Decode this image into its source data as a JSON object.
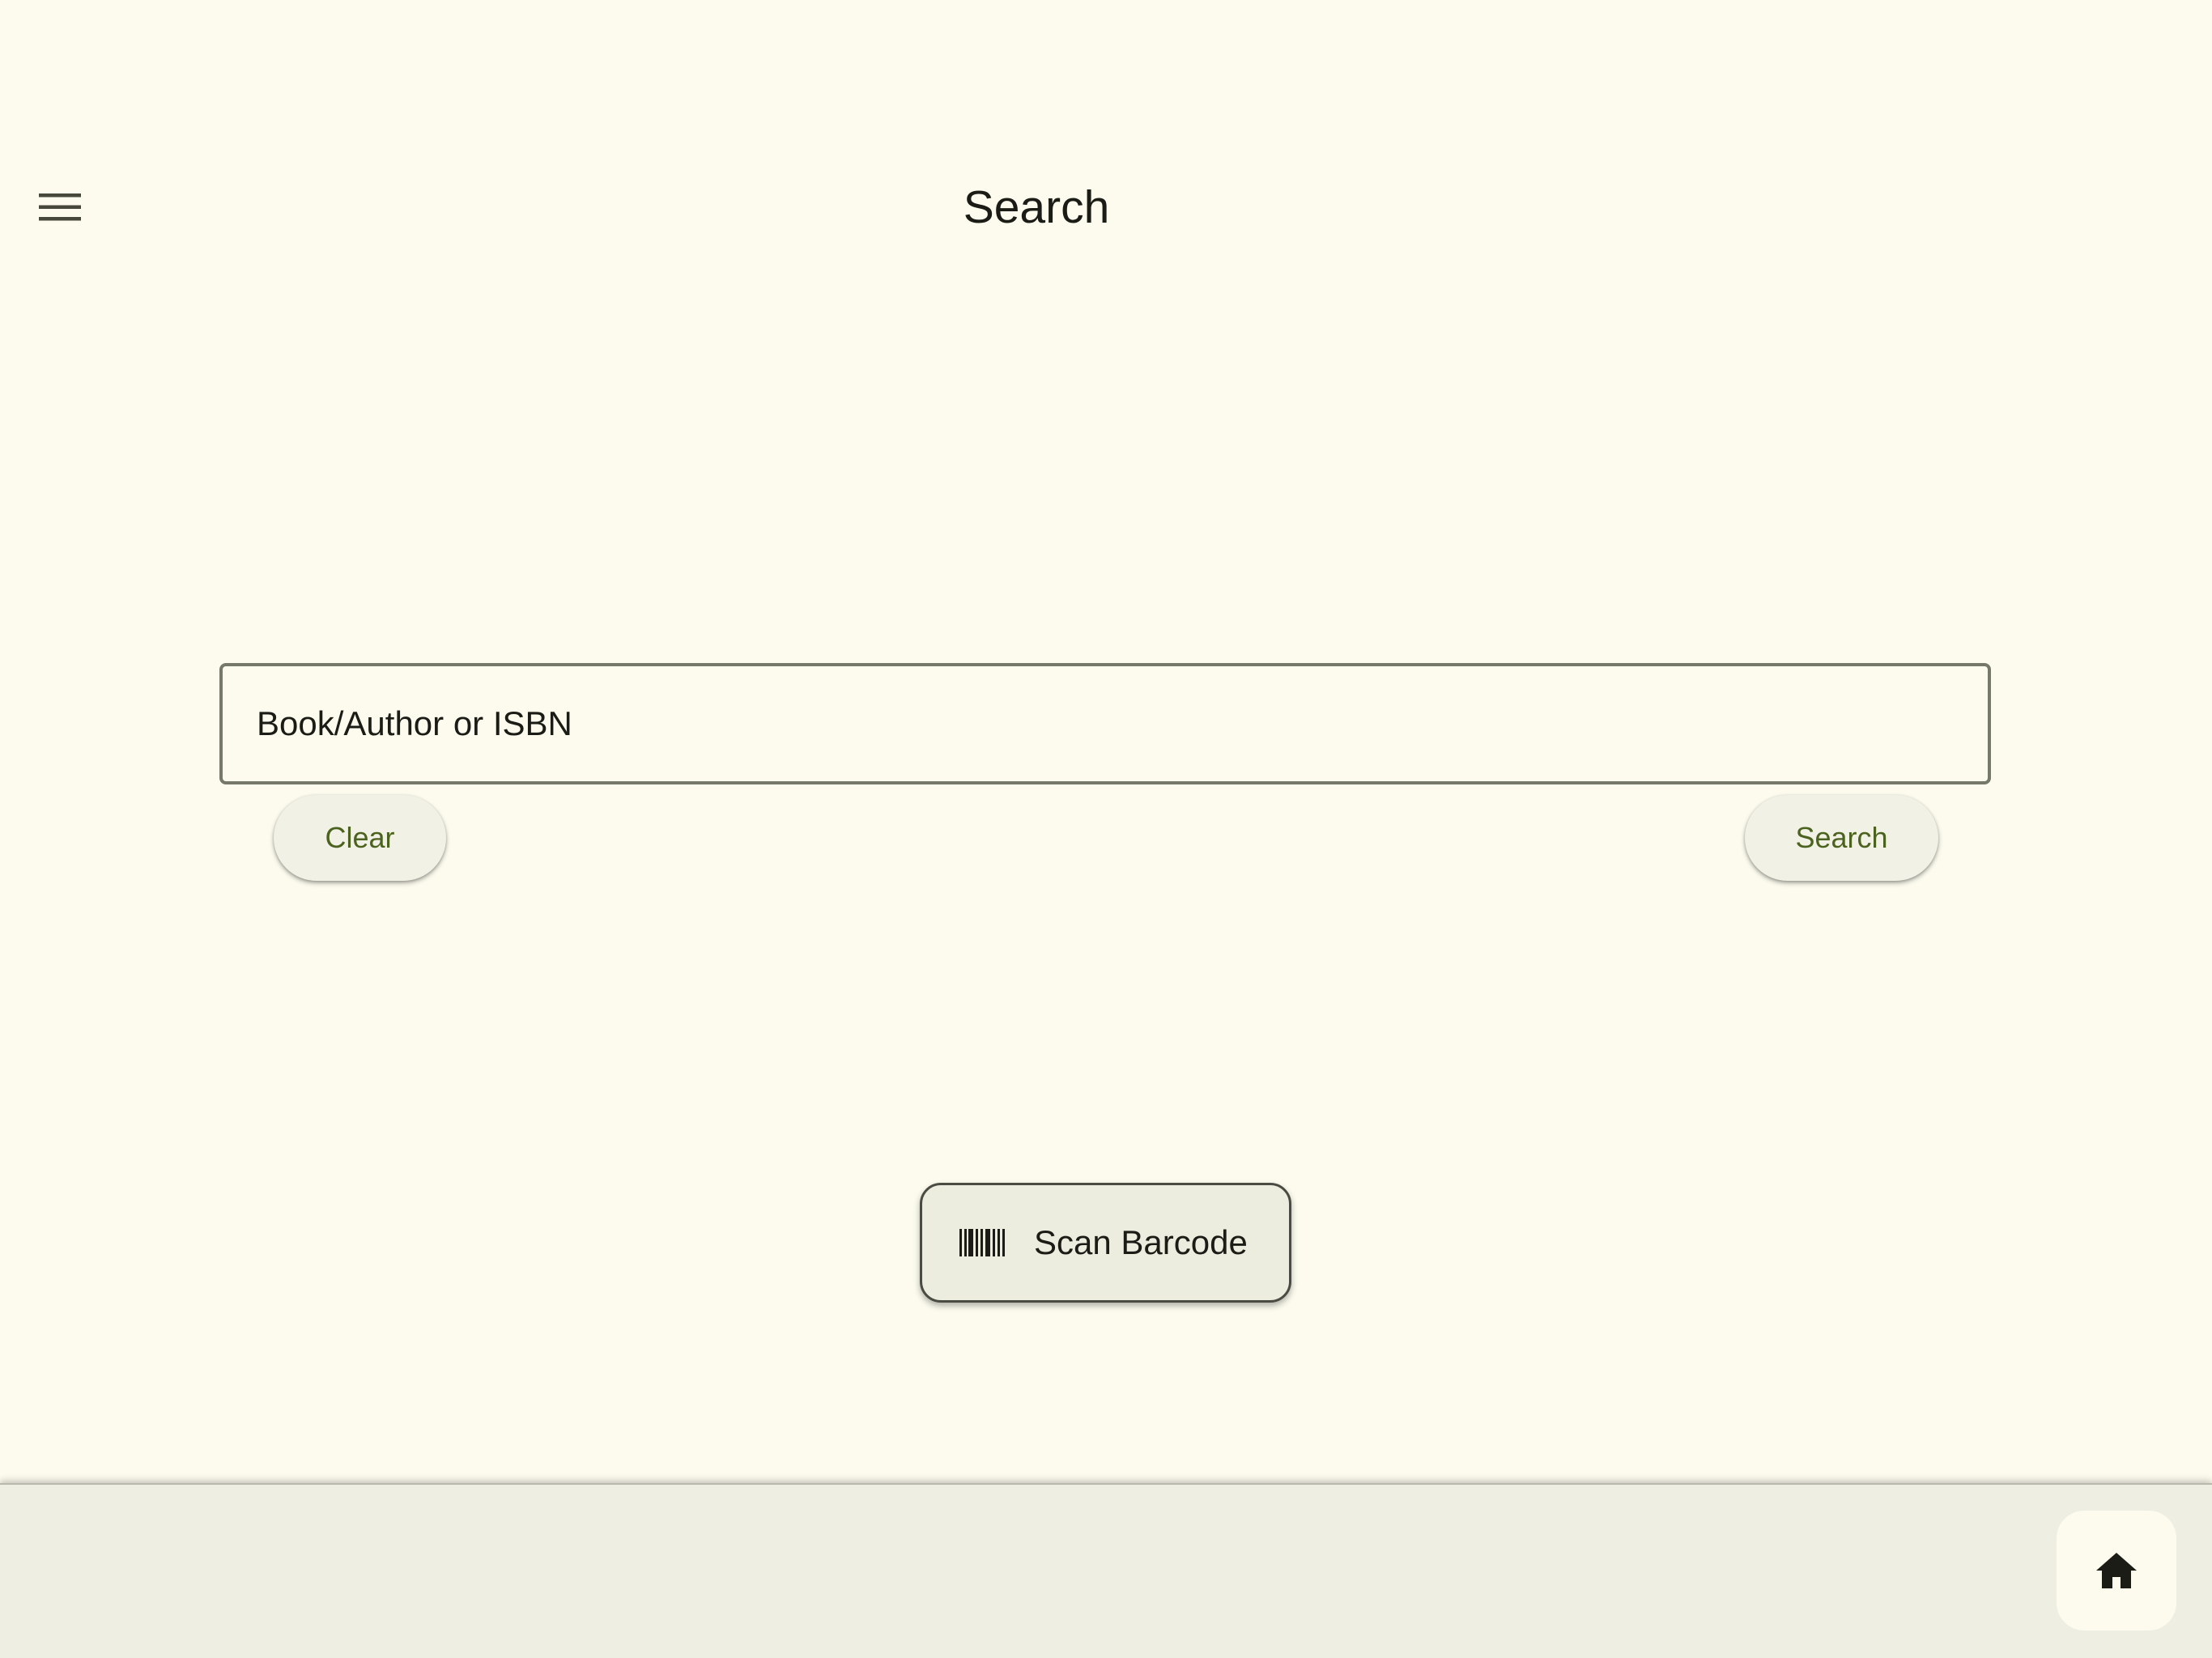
{
  "app_bar": {
    "title": "Search",
    "menu_icon": "hamburger-menu-icon"
  },
  "search": {
    "placeholder": "Book/Author or ISBN",
    "value": "",
    "clear_label": "Clear",
    "search_label": "Search"
  },
  "scan": {
    "icon": "barcode-icon",
    "label": "Scan Barcode"
  },
  "bottom_bar": {
    "home_icon": "home-icon"
  },
  "colors": {
    "background": "#fcfbee",
    "accent_text": "#4c6320",
    "primary_text": "#1b1c15",
    "outline": "#76786a",
    "bottom_bar": "#efeee2"
  }
}
